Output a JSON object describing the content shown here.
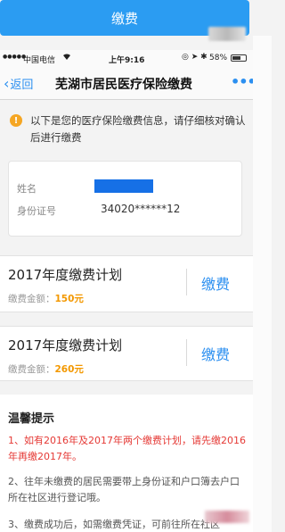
{
  "top_button": {
    "label": "缴费"
  },
  "status_bar": {
    "signal_dots": "●●●●●",
    "carrier": "中国电信",
    "wifi_icon": "wifi-icon",
    "time": "上午9:16",
    "system_icons": "◎ ➤ ✱",
    "battery": "58%"
  },
  "nav": {
    "back_label": "返回",
    "title": "芜湖市居民医疗保险缴费",
    "more": "•••"
  },
  "notice": {
    "icon": "!",
    "text": "以下是您的医疗保险缴费信息，请仔细核对确认后进行缴费"
  },
  "info": {
    "name_label": "姓名",
    "id_label": "身份证号",
    "id_value": "34020******12"
  },
  "plans": [
    {
      "title": "2017年度缴费计划",
      "amount_label": "缴费金额：",
      "amount": "150元",
      "pay_label": "缴费"
    },
    {
      "title": "2017年度缴费计划",
      "amount_label": "缴费金额：",
      "amount": "260元",
      "pay_label": "缴费"
    }
  ],
  "tips": {
    "title": "温馨提示",
    "items": [
      "1、如有2016年及2017年两个缴费计划，请先缴2016年再缴2017年。",
      "2、往年未缴费的居民需要带上身份证和户口簿去户口所在社区进行登记哦。",
      "3、缴费成功后，如需缴费凭证，可前往所在社区"
    ]
  },
  "colors": {
    "accent": "#2b8ff0",
    "button_bg": "#2b9cf2",
    "warning": "#f5a623",
    "amount": "#f39800",
    "alert_text": "#e53935"
  }
}
